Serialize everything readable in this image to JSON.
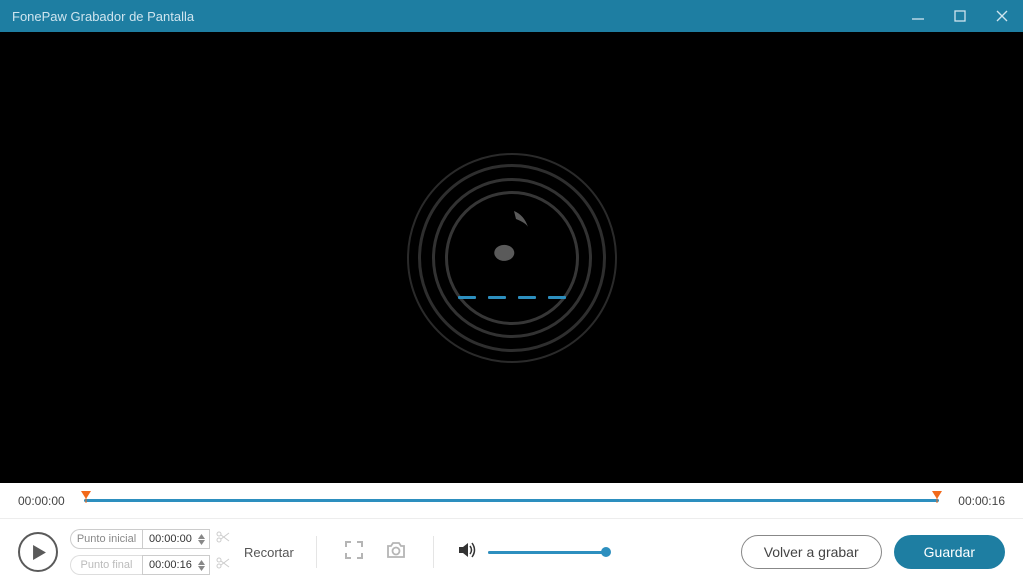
{
  "title": "FonePaw Grabador de Pantalla",
  "timeline": {
    "start": "00:00:00",
    "end": "00:00:16"
  },
  "trim": {
    "start_label": "Punto inicial",
    "end_label": "Punto final",
    "start_value": "00:00:00",
    "end_value": "00:00:16",
    "cut_label": "Recortar"
  },
  "volume": {
    "percent": 100
  },
  "buttons": {
    "rerecord": "Volver a grabar",
    "save": "Guardar"
  },
  "colors": {
    "primary": "#1e7ea2",
    "accent": "#2d8fbf"
  }
}
